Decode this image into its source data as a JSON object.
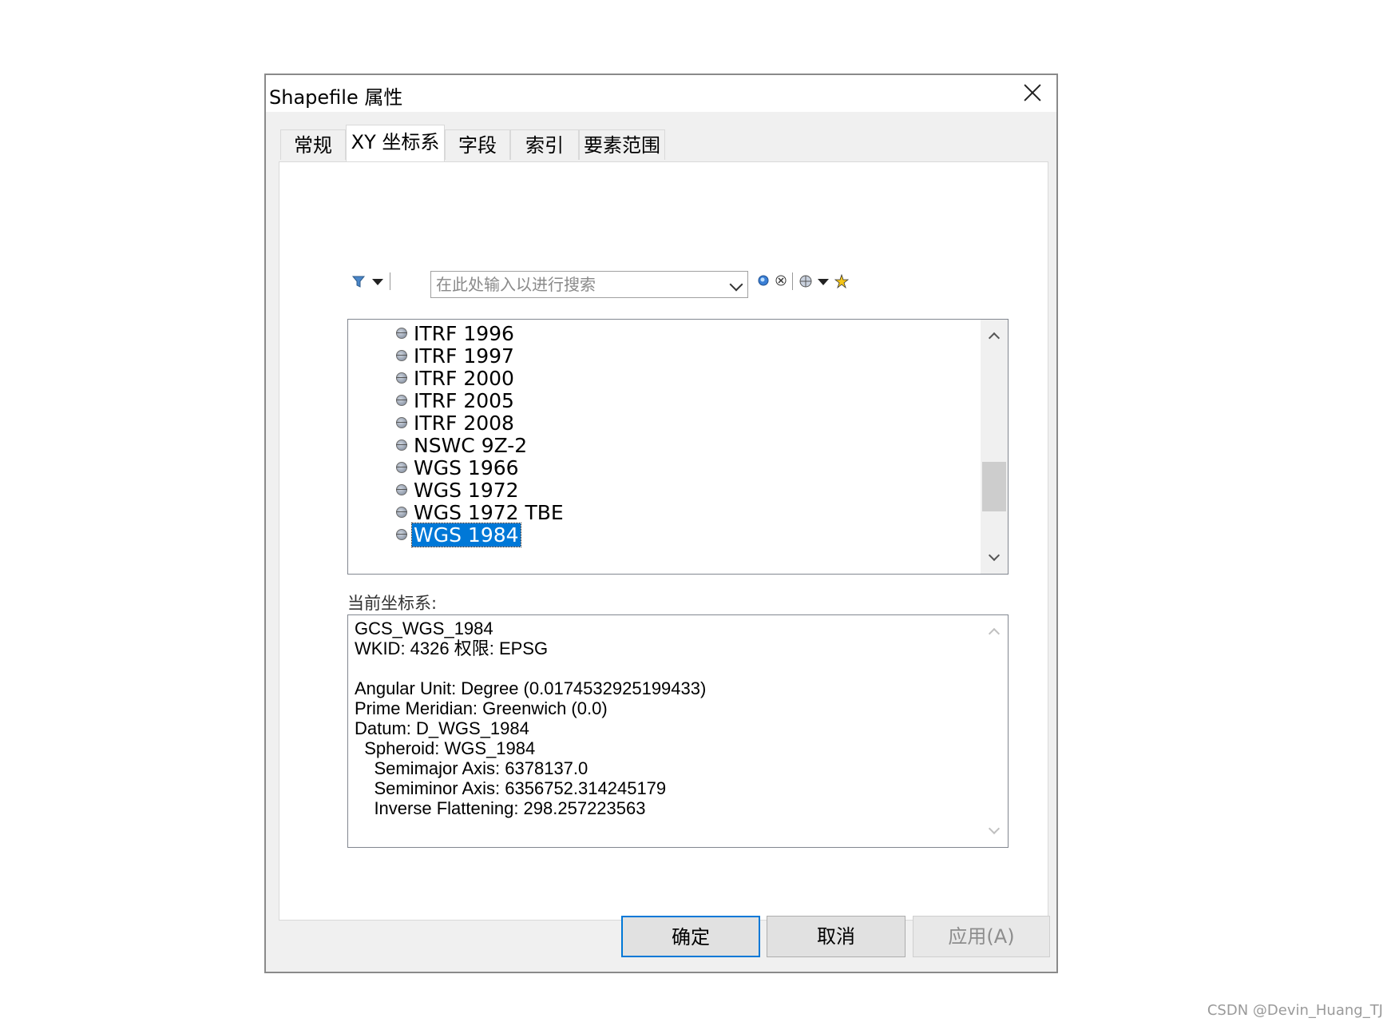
{
  "window": {
    "title": "Shapefile 属性"
  },
  "tabs": [
    {
      "label": "常规"
    },
    {
      "label": "XY 坐标系",
      "active": true
    },
    {
      "label": "字段"
    },
    {
      "label": "索引"
    },
    {
      "label": "要素范围"
    }
  ],
  "toolbar": {
    "search_placeholder": "在此处输入以进行搜索",
    "icons": [
      "filter-icon",
      "dropdown-arrow-icon",
      "search-icon",
      "clear-search-icon",
      "globe-icon",
      "dropdown-arrow-icon",
      "favorite-star-icon"
    ]
  },
  "tree": {
    "items": [
      {
        "label": "ITRF 1996"
      },
      {
        "label": "ITRF 1997"
      },
      {
        "label": "ITRF 2000"
      },
      {
        "label": "ITRF 2005"
      },
      {
        "label": "ITRF 2008"
      },
      {
        "label": "NSWC 9Z-2"
      },
      {
        "label": "WGS 1966"
      },
      {
        "label": "WGS 1972"
      },
      {
        "label": "WGS 1972 TBE"
      },
      {
        "label": "WGS 1984",
        "selected": true
      }
    ]
  },
  "current": {
    "label": "当前坐标系:",
    "text": "GCS_WGS_1984\nWKID: 4326 权限: EPSG\n\nAngular Unit: Degree (0.0174532925199433)\nPrime Meridian: Greenwich (0.0)\nDatum: D_WGS_1984\n  Spheroid: WGS_1984\n    Semimajor Axis: 6378137.0\n    Semiminor Axis: 6356752.314245179\n    Inverse Flattening: 298.257223563"
  },
  "buttons": {
    "ok": "确定",
    "cancel": "取消",
    "apply": "应用(A)"
  },
  "watermark": "CSDN @Devin_Huang_TJ",
  "colors": {
    "selection": "#0078d7",
    "dialog_bg": "#f0f0f0"
  }
}
